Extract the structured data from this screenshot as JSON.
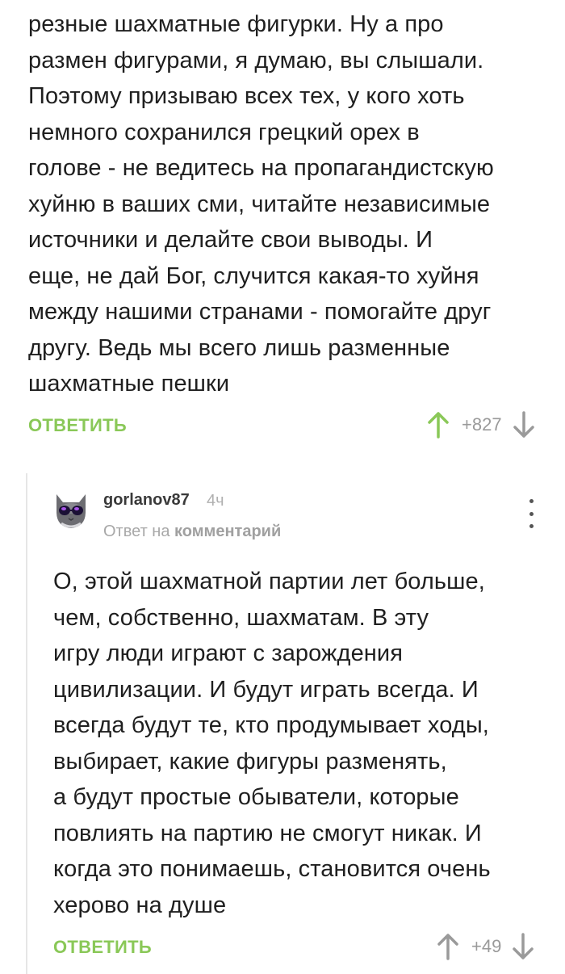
{
  "parent": {
    "text": "резные шахматные фигурки. Ну а про\nразмен фигурами, я думаю, вы слышали.\nПоэтому призываю всех тех, у кого хоть\nнемного сохранился грецкий орех в\nголове - не ведитесь на пропагандистскую\nхуйню в ваших сми, читайте независимые\nисточники и делайте свои выводы. И\nеще, не дай Бог, случится какая-то хуйня\nмежду нашими странами - помогайте друг\nдругу. Ведь мы всего лишь разменные\nшахматные пешки",
    "reply_label": "ОТВЕТИТЬ",
    "score": "+827"
  },
  "reply": {
    "author": "gorlanov87",
    "time": "4ч",
    "reply_to_prefix": "Ответ на",
    "reply_to_target": "комментарий",
    "text": "О, этой шахматной партии лет больше,\nчем, собственно, шахматам. В эту\nигру люди играют с зарождения\nцивилизации. И будут играть всегда. И\nвсегда будут те, кто продумывает ходы,\nвыбирает, какие фигуры разменять,\nа будут простые обыватели, которые\nповлиять на партию не смогут никак. И\nкогда это понимаешь, становится очень\nхерово на душе",
    "reply_label": "ОТВЕТИТЬ",
    "score": "+49"
  },
  "icons": {
    "upvote": "arrow-up-icon",
    "downvote": "arrow-down-icon",
    "menu": "more-vertical-icon",
    "avatar": "cat-with-sunglasses-avatar"
  },
  "colors": {
    "accent_green": "#8ac858",
    "muted_gray": "#9a9a9a",
    "text": "#1f1f1f"
  }
}
